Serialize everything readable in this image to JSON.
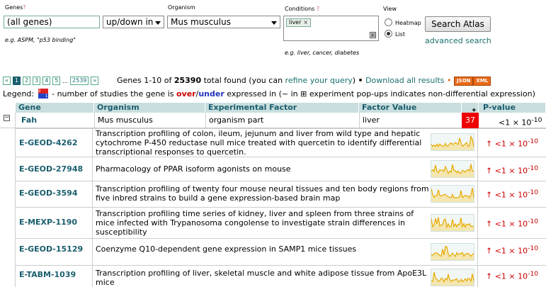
{
  "search": {
    "genes_label": "Genes",
    "help": "?",
    "genes_value": "(all genes)",
    "genes_hint": "e.g. ASPM, \"p53 binding\"",
    "regulation_value": "up/down in",
    "organism_label": "Organism",
    "organism_value": "Mus musculus",
    "conditions_label": "Conditions",
    "condition_tag": "liver",
    "condition_tag_remove": "×",
    "conditions_add": "⊞",
    "conditions_hint": "e.g. liver, cancer, diabetes",
    "view_label": "View",
    "view_heatmap": "Heatmap",
    "view_list": "List",
    "submit": "Search Atlas",
    "advanced": "advanced search"
  },
  "pager": {
    "prev": "«",
    "pages": [
      "1",
      "2",
      "3",
      "4",
      "5"
    ],
    "dots": "...",
    "last": "2539",
    "next": "»"
  },
  "summary": {
    "prefix": "Genes 1-10 of ",
    "total": "25390",
    "middle": " total found (you can ",
    "refine": "refine your query",
    "suffix": ")",
    "bullet": "•",
    "download": "Download all results",
    "json": "JSON",
    "xml": "XML"
  },
  "legend": {
    "label": "Legend:",
    "icon_up": "3",
    "icon_down": "1",
    "text_a": " - number of studies the gene is ",
    "over": "over",
    "slash": "/",
    "under": "under",
    "text_b": " expressed in (~ in ⊞ experiment pop-ups indicates non-differential expression)"
  },
  "table": {
    "headers": [
      "Gene",
      "Organism",
      "Experimental Factor",
      "Factor Value",
      "",
      "P-value"
    ],
    "expand": "−",
    "gene": {
      "name": "Fah",
      "organism": "Mus musculus",
      "factor": "organism part",
      "factor_value": "liver",
      "count": "37",
      "pvalue": "<1 × 10",
      "pvalue_exp": "-10"
    },
    "experiments": [
      {
        "accession": "E-GEOD-4262",
        "title": "Transcription profiling of colon, ileum, jejunum and liver from wild type and hepatic cytochrome P-450 reductase null mice treated with quercetin to identify differential transcriptional responses to quercetin.",
        "pvalue": "↑ <1 × 10",
        "exp": "-10"
      },
      {
        "accession": "E-GEOD-27948",
        "title": "Pharmacology of PPAR isoform agonists on mouse",
        "pvalue": "↑ <1 × 10",
        "exp": "-10"
      },
      {
        "accession": "E-GEOD-3594",
        "title": "Transcription profiling of twenty four mouse neural tissues and ten body regions from five inbred strains to build a gene expression-based brain map",
        "pvalue": "↑ <1 × 10",
        "exp": "-10"
      },
      {
        "accession": "E-MEXP-1190",
        "title": "Transcription profiling time series of kidney, liver and spleen from three strains of mice infected with Trypanosoma congolense to investigate strain differences in susceptibility",
        "pvalue": "↑ <1 × 10",
        "exp": "-10"
      },
      {
        "accession": "E-GEOD-15129",
        "title": "Coenzyme Q10-dependent gene expression in SAMP1 mice tissues",
        "pvalue": "↑ <1 × 10",
        "exp": "-10"
      },
      {
        "accession": "E-TABM-1039",
        "title": "Transcription profiling of liver, skeletal muscle and white adipose tissue from ApoE3L mice",
        "pvalue": "↑ <1 × 10",
        "exp": "-10"
      }
    ]
  },
  "colors": {
    "header_bg": "#c9dede",
    "link": "#1a6e6e",
    "up": "#cc0000",
    "down": "#2233bb",
    "spark": "#e8a800"
  }
}
